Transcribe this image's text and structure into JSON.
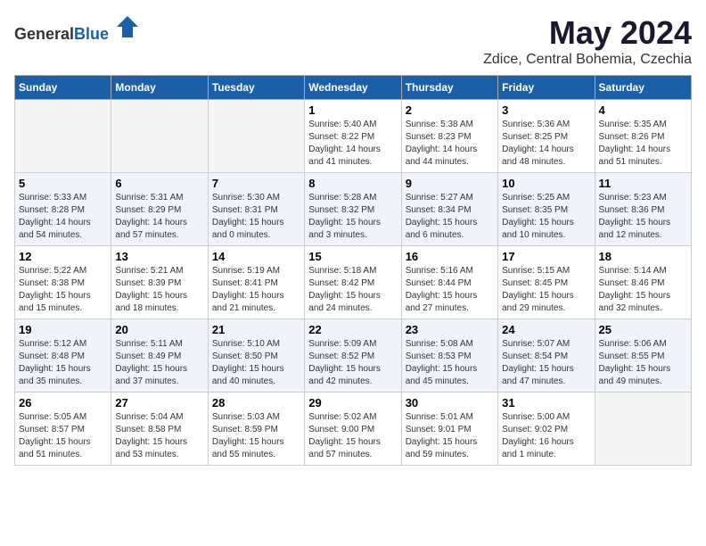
{
  "header": {
    "logo_general": "General",
    "logo_blue": "Blue",
    "month_year": "May 2024",
    "location": "Zdice, Central Bohemia, Czechia"
  },
  "weekdays": [
    "Sunday",
    "Monday",
    "Tuesday",
    "Wednesday",
    "Thursday",
    "Friday",
    "Saturday"
  ],
  "weeks": [
    [
      {
        "day": "",
        "sunrise": "",
        "sunset": "",
        "daylight": "",
        "empty": true
      },
      {
        "day": "",
        "sunrise": "",
        "sunset": "",
        "daylight": "",
        "empty": true
      },
      {
        "day": "",
        "sunrise": "",
        "sunset": "",
        "daylight": "",
        "empty": true
      },
      {
        "day": "1",
        "sunrise": "Sunrise: 5:40 AM",
        "sunset": "Sunset: 8:22 PM",
        "daylight": "Daylight: 14 hours and 41 minutes."
      },
      {
        "day": "2",
        "sunrise": "Sunrise: 5:38 AM",
        "sunset": "Sunset: 8:23 PM",
        "daylight": "Daylight: 14 hours and 44 minutes."
      },
      {
        "day": "3",
        "sunrise": "Sunrise: 5:36 AM",
        "sunset": "Sunset: 8:25 PM",
        "daylight": "Daylight: 14 hours and 48 minutes."
      },
      {
        "day": "4",
        "sunrise": "Sunrise: 5:35 AM",
        "sunset": "Sunset: 8:26 PM",
        "daylight": "Daylight: 14 hours and 51 minutes."
      }
    ],
    [
      {
        "day": "5",
        "sunrise": "Sunrise: 5:33 AM",
        "sunset": "Sunset: 8:28 PM",
        "daylight": "Daylight: 14 hours and 54 minutes."
      },
      {
        "day": "6",
        "sunrise": "Sunrise: 5:31 AM",
        "sunset": "Sunset: 8:29 PM",
        "daylight": "Daylight: 14 hours and 57 minutes."
      },
      {
        "day": "7",
        "sunrise": "Sunrise: 5:30 AM",
        "sunset": "Sunset: 8:31 PM",
        "daylight": "Daylight: 15 hours and 0 minutes."
      },
      {
        "day": "8",
        "sunrise": "Sunrise: 5:28 AM",
        "sunset": "Sunset: 8:32 PM",
        "daylight": "Daylight: 15 hours and 3 minutes."
      },
      {
        "day": "9",
        "sunrise": "Sunrise: 5:27 AM",
        "sunset": "Sunset: 8:34 PM",
        "daylight": "Daylight: 15 hours and 6 minutes."
      },
      {
        "day": "10",
        "sunrise": "Sunrise: 5:25 AM",
        "sunset": "Sunset: 8:35 PM",
        "daylight": "Daylight: 15 hours and 10 minutes."
      },
      {
        "day": "11",
        "sunrise": "Sunrise: 5:23 AM",
        "sunset": "Sunset: 8:36 PM",
        "daylight": "Daylight: 15 hours and 12 minutes."
      }
    ],
    [
      {
        "day": "12",
        "sunrise": "Sunrise: 5:22 AM",
        "sunset": "Sunset: 8:38 PM",
        "daylight": "Daylight: 15 hours and 15 minutes."
      },
      {
        "day": "13",
        "sunrise": "Sunrise: 5:21 AM",
        "sunset": "Sunset: 8:39 PM",
        "daylight": "Daylight: 15 hours and 18 minutes."
      },
      {
        "day": "14",
        "sunrise": "Sunrise: 5:19 AM",
        "sunset": "Sunset: 8:41 PM",
        "daylight": "Daylight: 15 hours and 21 minutes."
      },
      {
        "day": "15",
        "sunrise": "Sunrise: 5:18 AM",
        "sunset": "Sunset: 8:42 PM",
        "daylight": "Daylight: 15 hours and 24 minutes."
      },
      {
        "day": "16",
        "sunrise": "Sunrise: 5:16 AM",
        "sunset": "Sunset: 8:44 PM",
        "daylight": "Daylight: 15 hours and 27 minutes."
      },
      {
        "day": "17",
        "sunrise": "Sunrise: 5:15 AM",
        "sunset": "Sunset: 8:45 PM",
        "daylight": "Daylight: 15 hours and 29 minutes."
      },
      {
        "day": "18",
        "sunrise": "Sunrise: 5:14 AM",
        "sunset": "Sunset: 8:46 PM",
        "daylight": "Daylight: 15 hours and 32 minutes."
      }
    ],
    [
      {
        "day": "19",
        "sunrise": "Sunrise: 5:12 AM",
        "sunset": "Sunset: 8:48 PM",
        "daylight": "Daylight: 15 hours and 35 minutes."
      },
      {
        "day": "20",
        "sunrise": "Sunrise: 5:11 AM",
        "sunset": "Sunset: 8:49 PM",
        "daylight": "Daylight: 15 hours and 37 minutes."
      },
      {
        "day": "21",
        "sunrise": "Sunrise: 5:10 AM",
        "sunset": "Sunset: 8:50 PM",
        "daylight": "Daylight: 15 hours and 40 minutes."
      },
      {
        "day": "22",
        "sunrise": "Sunrise: 5:09 AM",
        "sunset": "Sunset: 8:52 PM",
        "daylight": "Daylight: 15 hours and 42 minutes."
      },
      {
        "day": "23",
        "sunrise": "Sunrise: 5:08 AM",
        "sunset": "Sunset: 8:53 PM",
        "daylight": "Daylight: 15 hours and 45 minutes."
      },
      {
        "day": "24",
        "sunrise": "Sunrise: 5:07 AM",
        "sunset": "Sunset: 8:54 PM",
        "daylight": "Daylight: 15 hours and 47 minutes."
      },
      {
        "day": "25",
        "sunrise": "Sunrise: 5:06 AM",
        "sunset": "Sunset: 8:55 PM",
        "daylight": "Daylight: 15 hours and 49 minutes."
      }
    ],
    [
      {
        "day": "26",
        "sunrise": "Sunrise: 5:05 AM",
        "sunset": "Sunset: 8:57 PM",
        "daylight": "Daylight: 15 hours and 51 minutes."
      },
      {
        "day": "27",
        "sunrise": "Sunrise: 5:04 AM",
        "sunset": "Sunset: 8:58 PM",
        "daylight": "Daylight: 15 hours and 53 minutes."
      },
      {
        "day": "28",
        "sunrise": "Sunrise: 5:03 AM",
        "sunset": "Sunset: 8:59 PM",
        "daylight": "Daylight: 15 hours and 55 minutes."
      },
      {
        "day": "29",
        "sunrise": "Sunrise: 5:02 AM",
        "sunset": "Sunset: 9:00 PM",
        "daylight": "Daylight: 15 hours and 57 minutes."
      },
      {
        "day": "30",
        "sunrise": "Sunrise: 5:01 AM",
        "sunset": "Sunset: 9:01 PM",
        "daylight": "Daylight: 15 hours and 59 minutes."
      },
      {
        "day": "31",
        "sunrise": "Sunrise: 5:00 AM",
        "sunset": "Sunset: 9:02 PM",
        "daylight": "Daylight: 16 hours and 1 minute."
      },
      {
        "day": "",
        "sunrise": "",
        "sunset": "",
        "daylight": "",
        "empty": true
      }
    ]
  ]
}
